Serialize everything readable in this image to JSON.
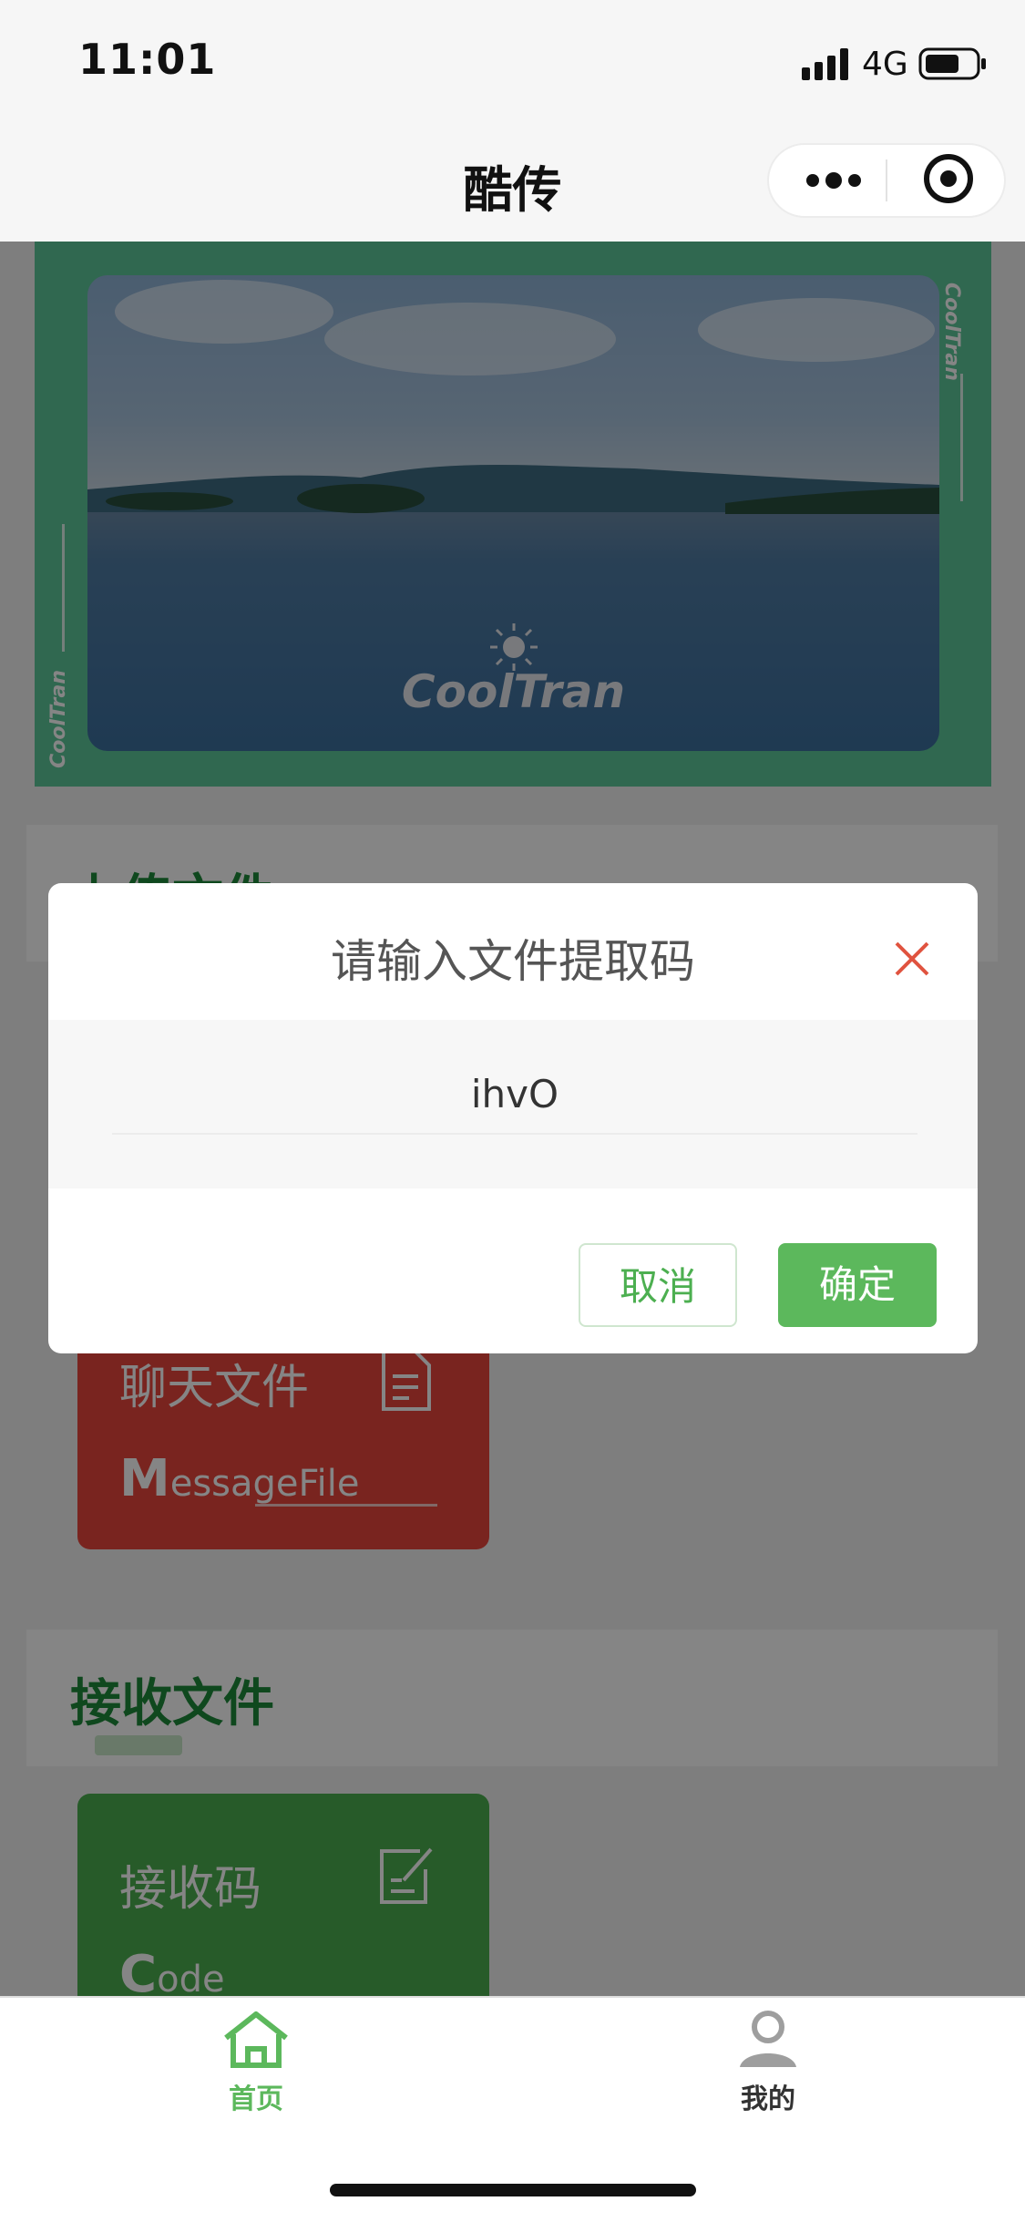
{
  "status_bar": {
    "time": "11:01",
    "network": "4G"
  },
  "navbar": {
    "title": "酷传"
  },
  "banner": {
    "brand": "CoolTran",
    "vertical_brand": "CoolTran"
  },
  "upload_section": {
    "title": "上传文件"
  },
  "message_card": {
    "title": "聊天文件",
    "sub_first": "M",
    "sub_rest": "essageFile",
    "color": "#e8453c"
  },
  "receive_section": {
    "title": "接收文件"
  },
  "code_card": {
    "title": "接收码",
    "sub_first": "C",
    "sub_rest": "ode",
    "color": "#4cae4f"
  },
  "dialog": {
    "title": "请输入文件提取码",
    "input_value": "ihvO",
    "cancel_label": "取消",
    "confirm_label": "确定"
  },
  "tabbar": {
    "items": [
      {
        "label": "首页",
        "icon": "home-icon",
        "active": true
      },
      {
        "label": "我的",
        "icon": "user-icon",
        "active": false
      }
    ],
    "active_color": "#5cb85c"
  }
}
